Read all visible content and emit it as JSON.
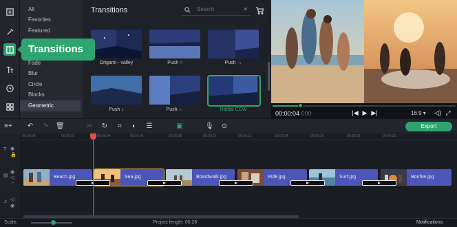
{
  "tool_rail": {
    "items": [
      {
        "icon": "import-icon",
        "active": false
      },
      {
        "icon": "magic-wand-icon",
        "active": false
      },
      {
        "icon": "transitions-icon",
        "active": true
      },
      {
        "icon": "titles-icon",
        "active": false
      },
      {
        "icon": "clock-icon",
        "active": false
      },
      {
        "icon": "grid-icon",
        "active": false
      }
    ]
  },
  "tooltip": "Transitions",
  "categories": {
    "items": [
      "All",
      "Favorites",
      "Featured",
      "",
      "",
      "Fade",
      "Blur",
      "Circle",
      "Blocks",
      "Geometric"
    ],
    "selected": "Geometric"
  },
  "panel": {
    "title": "Transitions",
    "search_placeholder": "Search",
    "search_clear": "✕",
    "transitions": [
      {
        "label": "Origami - valley",
        "selected": false
      },
      {
        "label": "Push ↑",
        "selected": false
      },
      {
        "label": "Push →",
        "selected": false
      },
      {
        "label": "Push ↓",
        "selected": false
      },
      {
        "label": "Push ←",
        "selected": false
      },
      {
        "label": "Radial CCW",
        "selected": true
      }
    ]
  },
  "preview": {
    "time_current": "00:00:04",
    "time_ms": "000",
    "seek_progress": 0.15,
    "aspect_ratio": "16:9 ▾"
  },
  "toolbar": {
    "export_label": "Export"
  },
  "timeline": {
    "ruler_ticks": [
      "00:00:00",
      "00:00:02",
      "00:00:04",
      "00:00:06",
      "00:00:08",
      "00:00:10",
      "00:00:12",
      "00:00:14",
      "00:00:16",
      "00:00:18",
      "00:00:20"
    ],
    "clips": [
      {
        "name": "Beach.jpg",
        "selected": false
      },
      {
        "name": "Sea.jpg",
        "selected": true
      },
      {
        "name": "Boardwalk.jpg",
        "selected": false
      },
      {
        "name": "Ride.jpg",
        "selected": false
      },
      {
        "name": "Surf.jpg",
        "selected": false
      },
      {
        "name": "Bonfire.jpg",
        "selected": false
      }
    ]
  },
  "status": {
    "scale_label": "Scale:",
    "project_length": "Project length:  00:28",
    "notifications": "Notifications"
  },
  "colors": {
    "accent": "#2fa472",
    "clip": "#4b56b8",
    "playhead": "#e05050"
  }
}
